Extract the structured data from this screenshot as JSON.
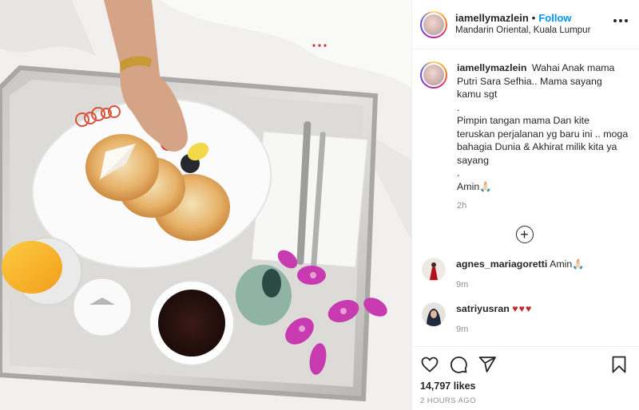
{
  "header": {
    "username": "iamellymazlein",
    "separator": "•",
    "follow_label": "Follow",
    "location": "Mandarin Oriental, Kuala Lumpur"
  },
  "caption": {
    "username": "iamellymazlein",
    "lines": [
      "Wahai Anak mama Putri Sara Sefhia.. Mama sayang kamu sgt",
      ".",
      "Pimpin tangan mama Dan kite teruskan perjalanan yg baru ini .. moga bahagia Dunia & Akhirat milik kita ya sayang",
      ".",
      "Amin🙏🏻"
    ],
    "time": "2h"
  },
  "comments": [
    {
      "username": "agnes_mariagoretti",
      "text": "Amin🙏🏻",
      "time": "9m"
    },
    {
      "username": "satriyusran",
      "text": "♥♥♥",
      "time": "9m"
    }
  ],
  "footer": {
    "likes": "14,797 likes",
    "date": "2 HOURS AGO"
  },
  "icons": {
    "like": "heart-icon",
    "comment": "comment-icon",
    "share": "paper-plane-icon",
    "save": "bookmark-icon",
    "more": "more-options-icon",
    "load_more": "plus-circle-icon"
  },
  "colors": {
    "follow": "#0095f6",
    "muted": "#8e8e8e",
    "text": "#262626"
  }
}
